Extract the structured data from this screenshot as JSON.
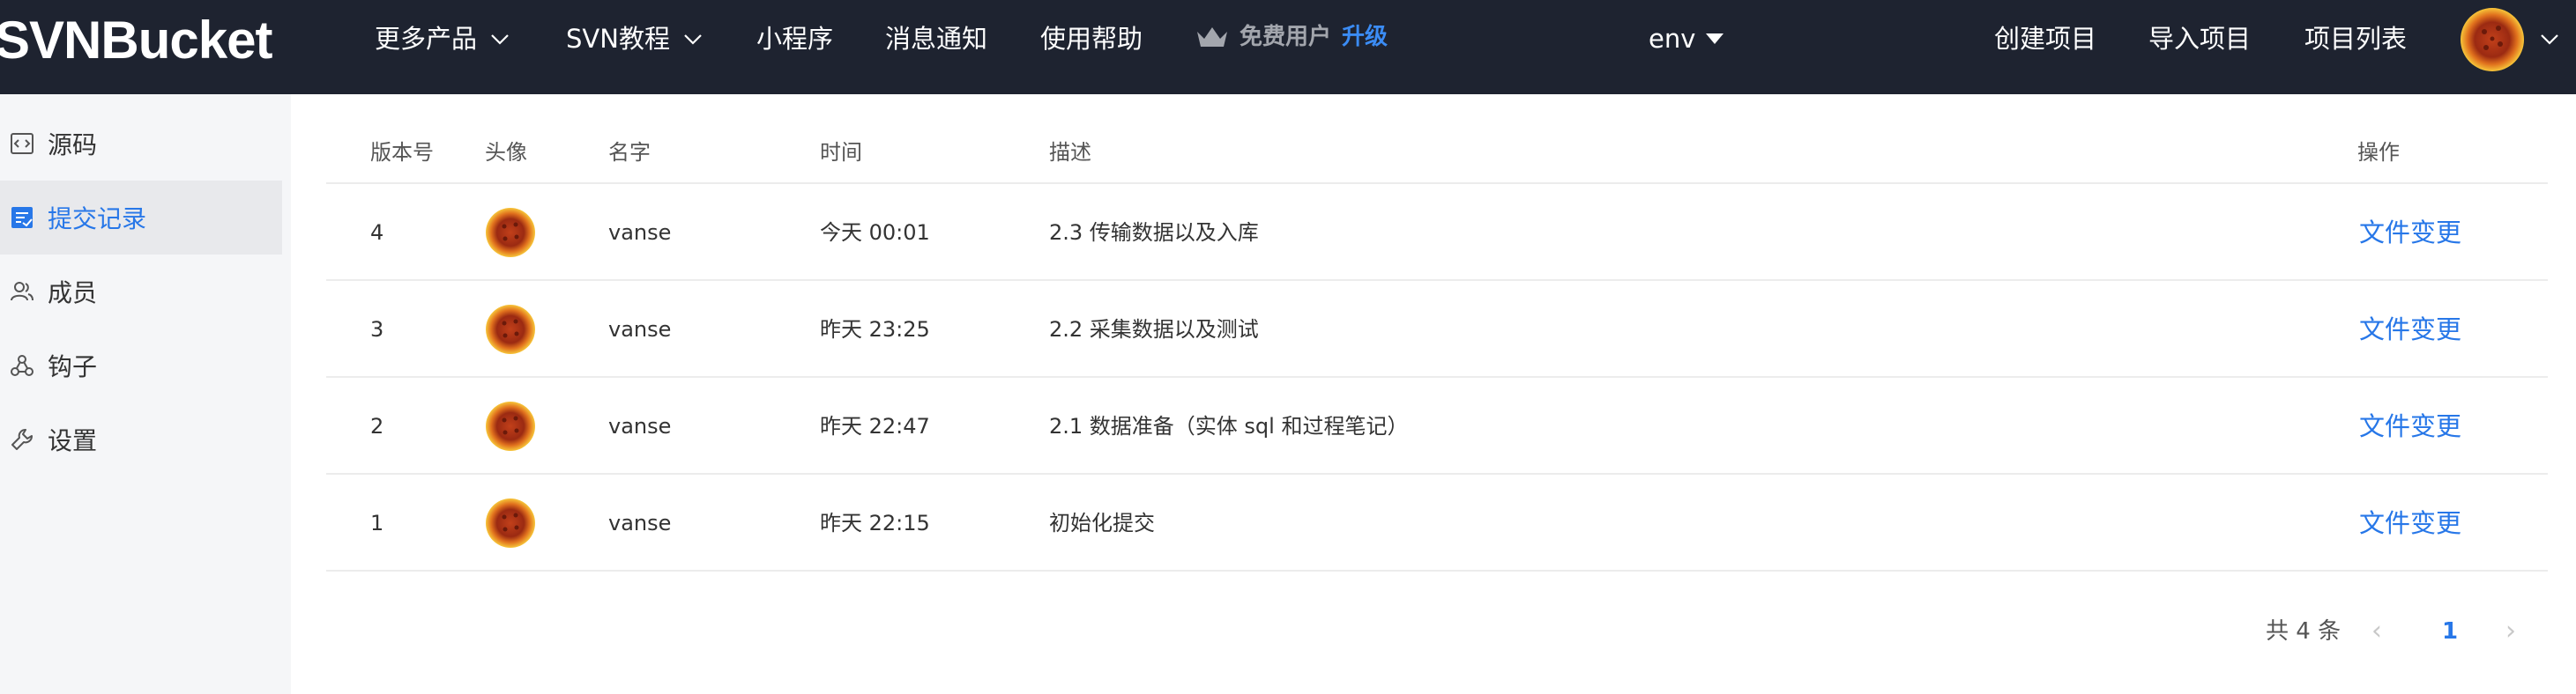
{
  "header": {
    "logo": "SVNBucket",
    "nav": [
      {
        "label": "更多产品"
      },
      {
        "label": "SVN教程"
      },
      {
        "label": "小程序"
      },
      {
        "label": "消息通知"
      },
      {
        "label": "使用帮助"
      }
    ],
    "free_user": "免费用户",
    "upgrade": "升级",
    "project_selector": "env",
    "actions": [
      {
        "label": "创建项目"
      },
      {
        "label": "导入项目"
      },
      {
        "label": "项目列表"
      }
    ]
  },
  "sidebar": {
    "items": [
      {
        "label": "源码",
        "icon": "code-file-icon"
      },
      {
        "label": "提交记录",
        "icon": "commit-log-icon",
        "active": true
      },
      {
        "label": "成员",
        "icon": "members-icon"
      },
      {
        "label": "钩子",
        "icon": "webhook-icon"
      },
      {
        "label": "设置",
        "icon": "wrench-icon"
      }
    ]
  },
  "table": {
    "columns": [
      "版本号",
      "头像",
      "名字",
      "时间",
      "描述",
      "操作"
    ],
    "rows": [
      {
        "version": "4",
        "name": "vanse",
        "time": "今天 00:01",
        "desc": "2.3 传输数据以及入库",
        "action": "文件变更"
      },
      {
        "version": "3",
        "name": "vanse",
        "time": "昨天 23:25",
        "desc": "2.2 采集数据以及测试",
        "action": "文件变更"
      },
      {
        "version": "2",
        "name": "vanse",
        "time": "昨天 22:47",
        "desc": "2.1 数据准备（实体 sql 和过程笔记）",
        "action": "文件变更"
      },
      {
        "version": "1",
        "name": "vanse",
        "time": "昨天 22:15",
        "desc": "初始化提交",
        "action": "文件变更"
      }
    ]
  },
  "pagination": {
    "total": "共 4 条",
    "prev": "‹",
    "current": "1",
    "next": "›"
  },
  "colors": {
    "topbar": "#1e2330",
    "accent": "#2777e8",
    "sidebar_bg": "#f5f6f8"
  }
}
